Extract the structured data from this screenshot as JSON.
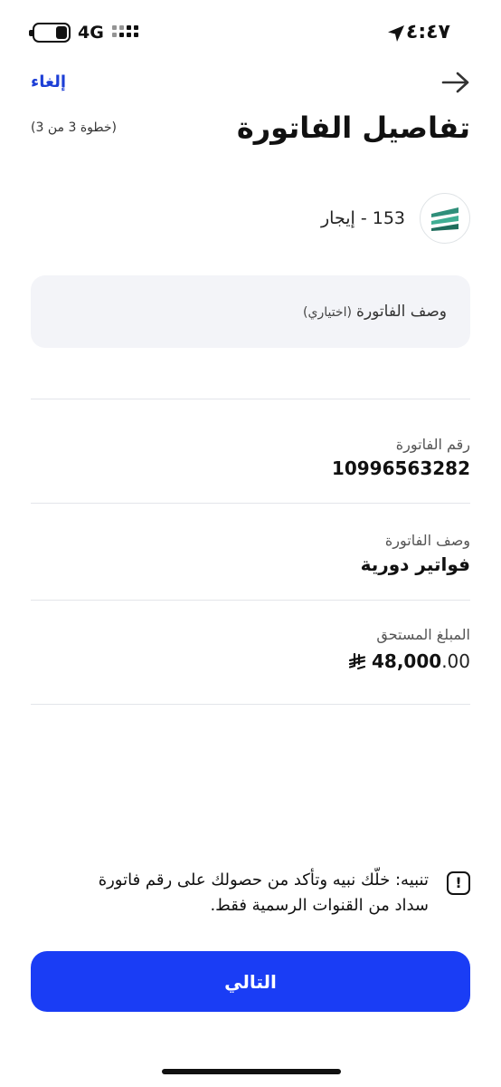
{
  "status_bar": {
    "time": "٤:٤٧",
    "network": "4G"
  },
  "header": {
    "cancel_label": "إلغاء",
    "title": "تفاصيل الفاتورة",
    "step": "(خطوة 3 من 3)"
  },
  "biller": {
    "name": "153 - إيجار"
  },
  "description_input": {
    "placeholder_main": "وصف الفاتورة",
    "placeholder_optional": "(اختياري)",
    "value": ""
  },
  "details": {
    "bill_number_label": "رقم الفاتورة",
    "bill_number_value": "10996563282",
    "bill_description_label": "وصف الفاتورة",
    "bill_description_value": "فواتير دورية",
    "amount_due_label": "المبلغ المستحق",
    "amount_integer": "48,000",
    "amount_decimal": ".00"
  },
  "warning": {
    "text": "تنبيه: خلّك نبيه وتأكد من حصولك على رقم فاتورة سداد من القنوات الرسمية فقط."
  },
  "next_button": {
    "label": "التالي"
  },
  "colors": {
    "primary": "#1a3df5",
    "link": "#1d3fd6",
    "input_bg": "#f3f4f8",
    "logo_green": "#2f8f7a"
  },
  "icons": {
    "back": "arrow-right-icon",
    "warning": "exclamation-icon",
    "currency": "saudi-riyal-icon",
    "location": "location-arrow-icon"
  }
}
